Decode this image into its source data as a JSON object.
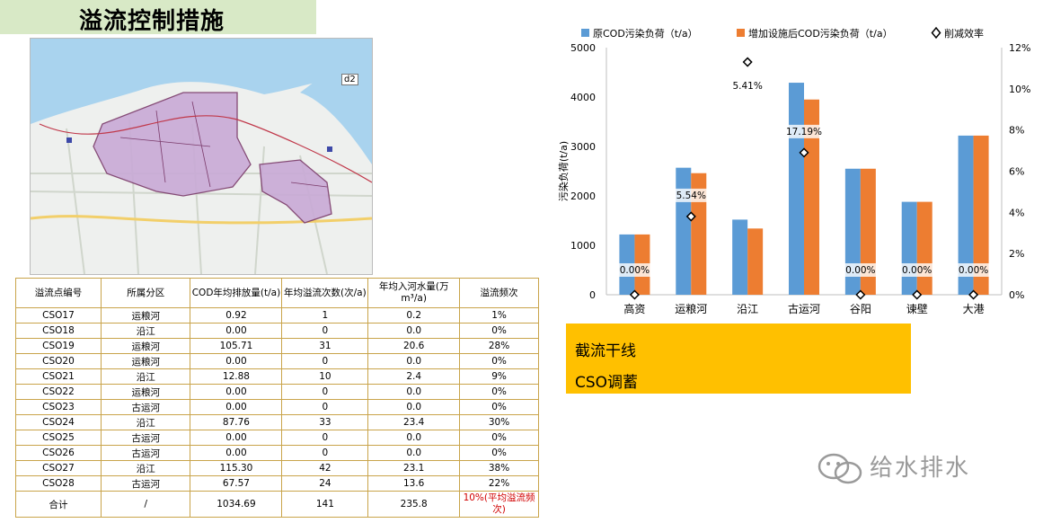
{
  "page": {
    "title": "溢流控制措施"
  },
  "map": {
    "label": "d2"
  },
  "table": {
    "headers": [
      "溢流点编号",
      "所属分区",
      "COD年均排放量(t/a)",
      "年均溢流次数(次/a)",
      "年均入河水量(万m³/a)",
      "溢流频次"
    ],
    "rows": [
      [
        "CSO17",
        "运粮河",
        "0.92",
        "1",
        "0.2",
        "1%"
      ],
      [
        "CSO18",
        "沿江",
        "0.00",
        "0",
        "0.0",
        "0%"
      ],
      [
        "CSO19",
        "运粮河",
        "105.71",
        "31",
        "20.6",
        "28%"
      ],
      [
        "CSO20",
        "运粮河",
        "0.00",
        "0",
        "0.0",
        "0%"
      ],
      [
        "CSO21",
        "沿江",
        "12.88",
        "10",
        "2.4",
        "9%"
      ],
      [
        "CSO22",
        "运粮河",
        "0.00",
        "0",
        "0.0",
        "0%"
      ],
      [
        "CSO23",
        "古运河",
        "0.00",
        "0",
        "0.0",
        "0%"
      ],
      [
        "CSO24",
        "沿江",
        "87.76",
        "33",
        "23.4",
        "30%"
      ],
      [
        "CSO25",
        "古运河",
        "0.00",
        "0",
        "0.0",
        "0%"
      ],
      [
        "CSO26",
        "古运河",
        "0.00",
        "0",
        "0.0",
        "0%"
      ],
      [
        "CSO27",
        "沿江",
        "115.30",
        "42",
        "23.1",
        "38%"
      ],
      [
        "CSO28",
        "古运河",
        "67.57",
        "24",
        "13.6",
        "22%"
      ]
    ],
    "total": [
      "合计",
      "/",
      "1034.69",
      "141",
      "235.8",
      "10%(平均溢流频次)"
    ]
  },
  "chart_data": {
    "type": "bar",
    "categories": [
      "高资",
      "运粮河",
      "沿江",
      "古运河",
      "谷阳",
      "谏壁",
      "大港"
    ],
    "series": [
      {
        "name": "原COD污染负荷（t/a）",
        "values": [
          1220,
          2570,
          1520,
          4290,
          2550,
          1880,
          3220
        ],
        "color": "#5b9bd5"
      },
      {
        "name": "增加设施后COD污染负荷（t/a）",
        "values": [
          1220,
          2460,
          1340,
          3950,
          2550,
          1880,
          3220
        ],
        "color": "#ed7d31"
      },
      {
        "name": "削减效率",
        "type": "scatter",
        "axis": "right",
        "values": [
          0,
          3.8,
          11.3,
          6.9,
          0,
          0,
          0
        ]
      }
    ],
    "data_labels": [
      "0.00%",
      "5.54%",
      "5.41%",
      "17.19%",
      "0.00%",
      "0.00%",
      "0.00%"
    ],
    "ylabel": "污染负荷(t/a)",
    "ylim": [
      0,
      5000
    ],
    "yticks": [
      "0",
      "1000",
      "2000",
      "3000",
      "4000",
      "5000"
    ],
    "y2lim": [
      0,
      12
    ],
    "y2ticks": [
      "0%",
      "2%",
      "4%",
      "6%",
      "8%",
      "10%",
      "12%"
    ],
    "legend_position": "top"
  },
  "measures": {
    "item1": "截流干线",
    "item2": "CSO调蓄"
  },
  "watermark": {
    "text": "给水排水"
  }
}
